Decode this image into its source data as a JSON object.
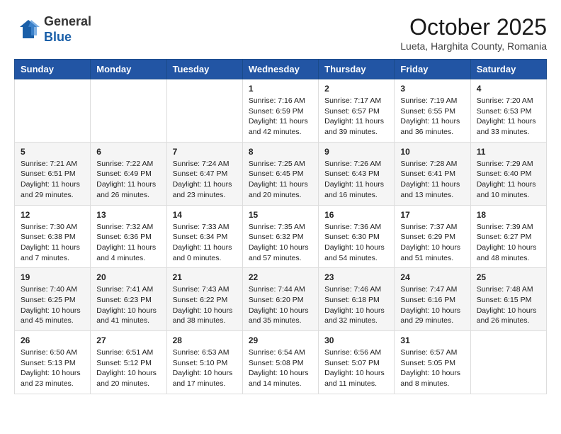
{
  "header": {
    "logo_line1": "General",
    "logo_line2": "Blue",
    "month": "October 2025",
    "location": "Lueta, Harghita County, Romania"
  },
  "weekdays": [
    "Sunday",
    "Monday",
    "Tuesday",
    "Wednesday",
    "Thursday",
    "Friday",
    "Saturday"
  ],
  "weeks": [
    [
      {
        "day": "",
        "info": ""
      },
      {
        "day": "",
        "info": ""
      },
      {
        "day": "",
        "info": ""
      },
      {
        "day": "1",
        "info": "Sunrise: 7:16 AM\nSunset: 6:59 PM\nDaylight: 11 hours\nand 42 minutes."
      },
      {
        "day": "2",
        "info": "Sunrise: 7:17 AM\nSunset: 6:57 PM\nDaylight: 11 hours\nand 39 minutes."
      },
      {
        "day": "3",
        "info": "Sunrise: 7:19 AM\nSunset: 6:55 PM\nDaylight: 11 hours\nand 36 minutes."
      },
      {
        "day": "4",
        "info": "Sunrise: 7:20 AM\nSunset: 6:53 PM\nDaylight: 11 hours\nand 33 minutes."
      }
    ],
    [
      {
        "day": "5",
        "info": "Sunrise: 7:21 AM\nSunset: 6:51 PM\nDaylight: 11 hours\nand 29 minutes."
      },
      {
        "day": "6",
        "info": "Sunrise: 7:22 AM\nSunset: 6:49 PM\nDaylight: 11 hours\nand 26 minutes."
      },
      {
        "day": "7",
        "info": "Sunrise: 7:24 AM\nSunset: 6:47 PM\nDaylight: 11 hours\nand 23 minutes."
      },
      {
        "day": "8",
        "info": "Sunrise: 7:25 AM\nSunset: 6:45 PM\nDaylight: 11 hours\nand 20 minutes."
      },
      {
        "day": "9",
        "info": "Sunrise: 7:26 AM\nSunset: 6:43 PM\nDaylight: 11 hours\nand 16 minutes."
      },
      {
        "day": "10",
        "info": "Sunrise: 7:28 AM\nSunset: 6:41 PM\nDaylight: 11 hours\nand 13 minutes."
      },
      {
        "day": "11",
        "info": "Sunrise: 7:29 AM\nSunset: 6:40 PM\nDaylight: 11 hours\nand 10 minutes."
      }
    ],
    [
      {
        "day": "12",
        "info": "Sunrise: 7:30 AM\nSunset: 6:38 PM\nDaylight: 11 hours\nand 7 minutes."
      },
      {
        "day": "13",
        "info": "Sunrise: 7:32 AM\nSunset: 6:36 PM\nDaylight: 11 hours\nand 4 minutes."
      },
      {
        "day": "14",
        "info": "Sunrise: 7:33 AM\nSunset: 6:34 PM\nDaylight: 11 hours\nand 0 minutes."
      },
      {
        "day": "15",
        "info": "Sunrise: 7:35 AM\nSunset: 6:32 PM\nDaylight: 10 hours\nand 57 minutes."
      },
      {
        "day": "16",
        "info": "Sunrise: 7:36 AM\nSunset: 6:30 PM\nDaylight: 10 hours\nand 54 minutes."
      },
      {
        "day": "17",
        "info": "Sunrise: 7:37 AM\nSunset: 6:29 PM\nDaylight: 10 hours\nand 51 minutes."
      },
      {
        "day": "18",
        "info": "Sunrise: 7:39 AM\nSunset: 6:27 PM\nDaylight: 10 hours\nand 48 minutes."
      }
    ],
    [
      {
        "day": "19",
        "info": "Sunrise: 7:40 AM\nSunset: 6:25 PM\nDaylight: 10 hours\nand 45 minutes."
      },
      {
        "day": "20",
        "info": "Sunrise: 7:41 AM\nSunset: 6:23 PM\nDaylight: 10 hours\nand 41 minutes."
      },
      {
        "day": "21",
        "info": "Sunrise: 7:43 AM\nSunset: 6:22 PM\nDaylight: 10 hours\nand 38 minutes."
      },
      {
        "day": "22",
        "info": "Sunrise: 7:44 AM\nSunset: 6:20 PM\nDaylight: 10 hours\nand 35 minutes."
      },
      {
        "day": "23",
        "info": "Sunrise: 7:46 AM\nSunset: 6:18 PM\nDaylight: 10 hours\nand 32 minutes."
      },
      {
        "day": "24",
        "info": "Sunrise: 7:47 AM\nSunset: 6:16 PM\nDaylight: 10 hours\nand 29 minutes."
      },
      {
        "day": "25",
        "info": "Sunrise: 7:48 AM\nSunset: 6:15 PM\nDaylight: 10 hours\nand 26 minutes."
      }
    ],
    [
      {
        "day": "26",
        "info": "Sunrise: 6:50 AM\nSunset: 5:13 PM\nDaylight: 10 hours\nand 23 minutes."
      },
      {
        "day": "27",
        "info": "Sunrise: 6:51 AM\nSunset: 5:12 PM\nDaylight: 10 hours\nand 20 minutes."
      },
      {
        "day": "28",
        "info": "Sunrise: 6:53 AM\nSunset: 5:10 PM\nDaylight: 10 hours\nand 17 minutes."
      },
      {
        "day": "29",
        "info": "Sunrise: 6:54 AM\nSunset: 5:08 PM\nDaylight: 10 hours\nand 14 minutes."
      },
      {
        "day": "30",
        "info": "Sunrise: 6:56 AM\nSunset: 5:07 PM\nDaylight: 10 hours\nand 11 minutes."
      },
      {
        "day": "31",
        "info": "Sunrise: 6:57 AM\nSunset: 5:05 PM\nDaylight: 10 hours\nand 8 minutes."
      },
      {
        "day": "",
        "info": ""
      }
    ]
  ]
}
